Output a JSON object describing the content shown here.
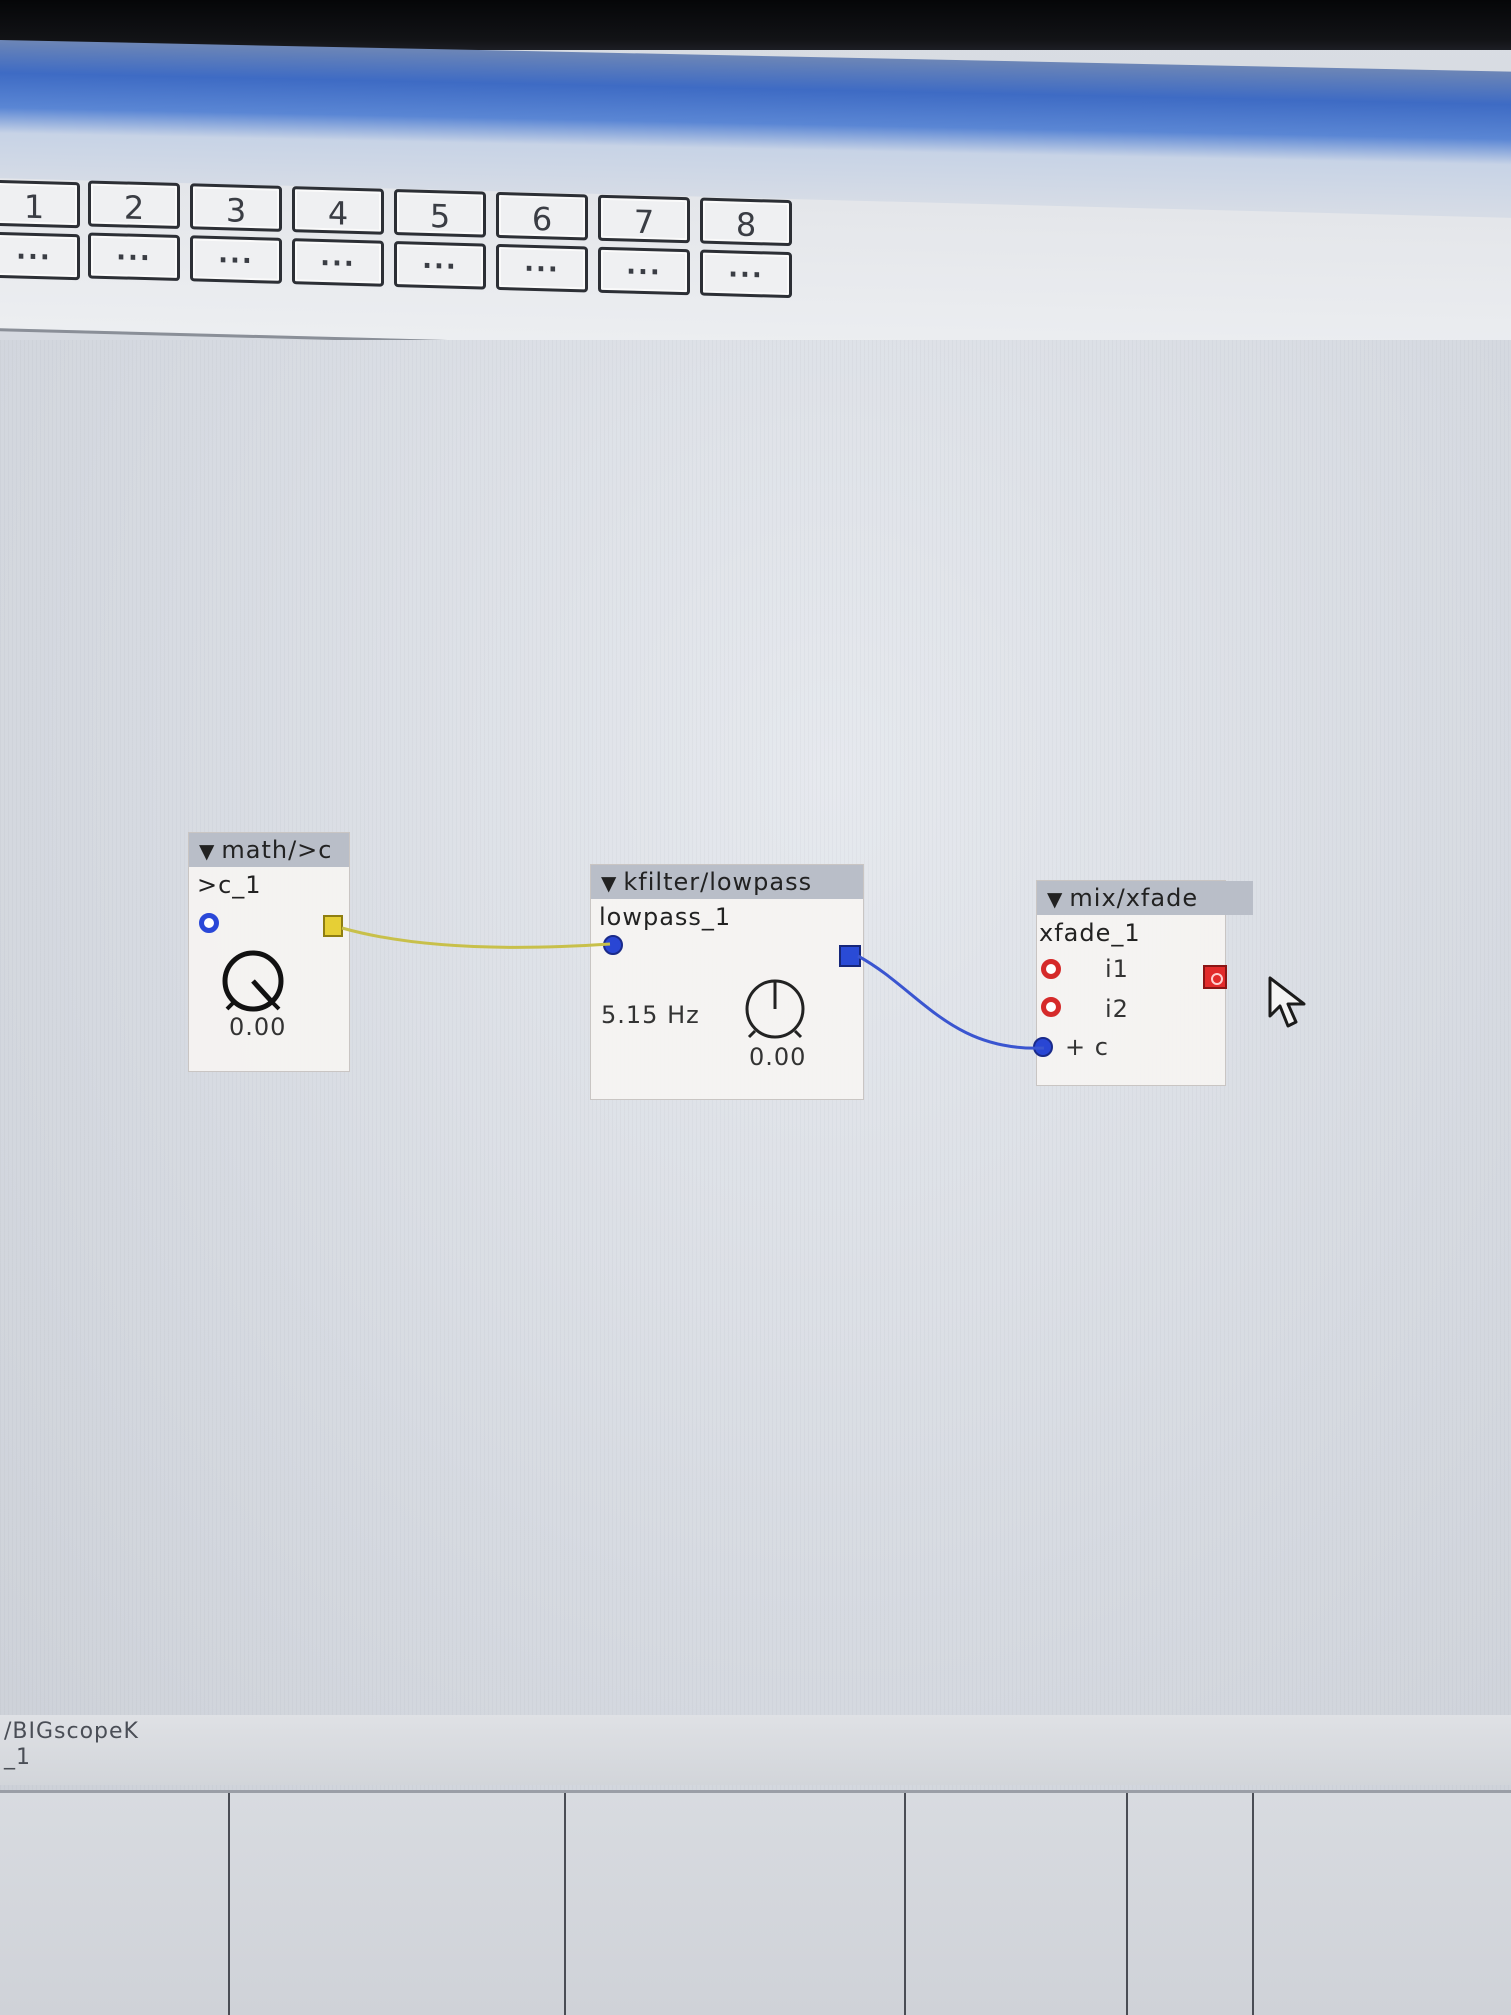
{
  "tabs": {
    "numbers": [
      "1",
      "2",
      "3",
      "4",
      "5",
      "6",
      "7",
      "8"
    ],
    "more_label": "..."
  },
  "modules": {
    "math": {
      "title": "math/>c",
      "instance": ">c_1",
      "knob_value": "0.00"
    },
    "lowpass": {
      "title": "kfilter/lowpass",
      "instance": "lowpass_1",
      "freq_value": "5.15 Hz",
      "knob_value": "0.00"
    },
    "xfade": {
      "title": "mix/xfade",
      "instance": "xfade_1",
      "inlet_i1": "i1",
      "inlet_i2": "i2",
      "inlet_c": "+ c"
    }
  },
  "status": {
    "line1": "/BIGscopeK",
    "line2": "_1"
  },
  "colors": {
    "wire_yellow": "#c8c04a",
    "wire_blue": "#3a55d0",
    "inlet_blue": "#2946d4",
    "inlet_red": "#d52a2a"
  },
  "icons": {
    "collapse": "triangle-down-icon",
    "cursor": "arrow-cursor-icon"
  }
}
